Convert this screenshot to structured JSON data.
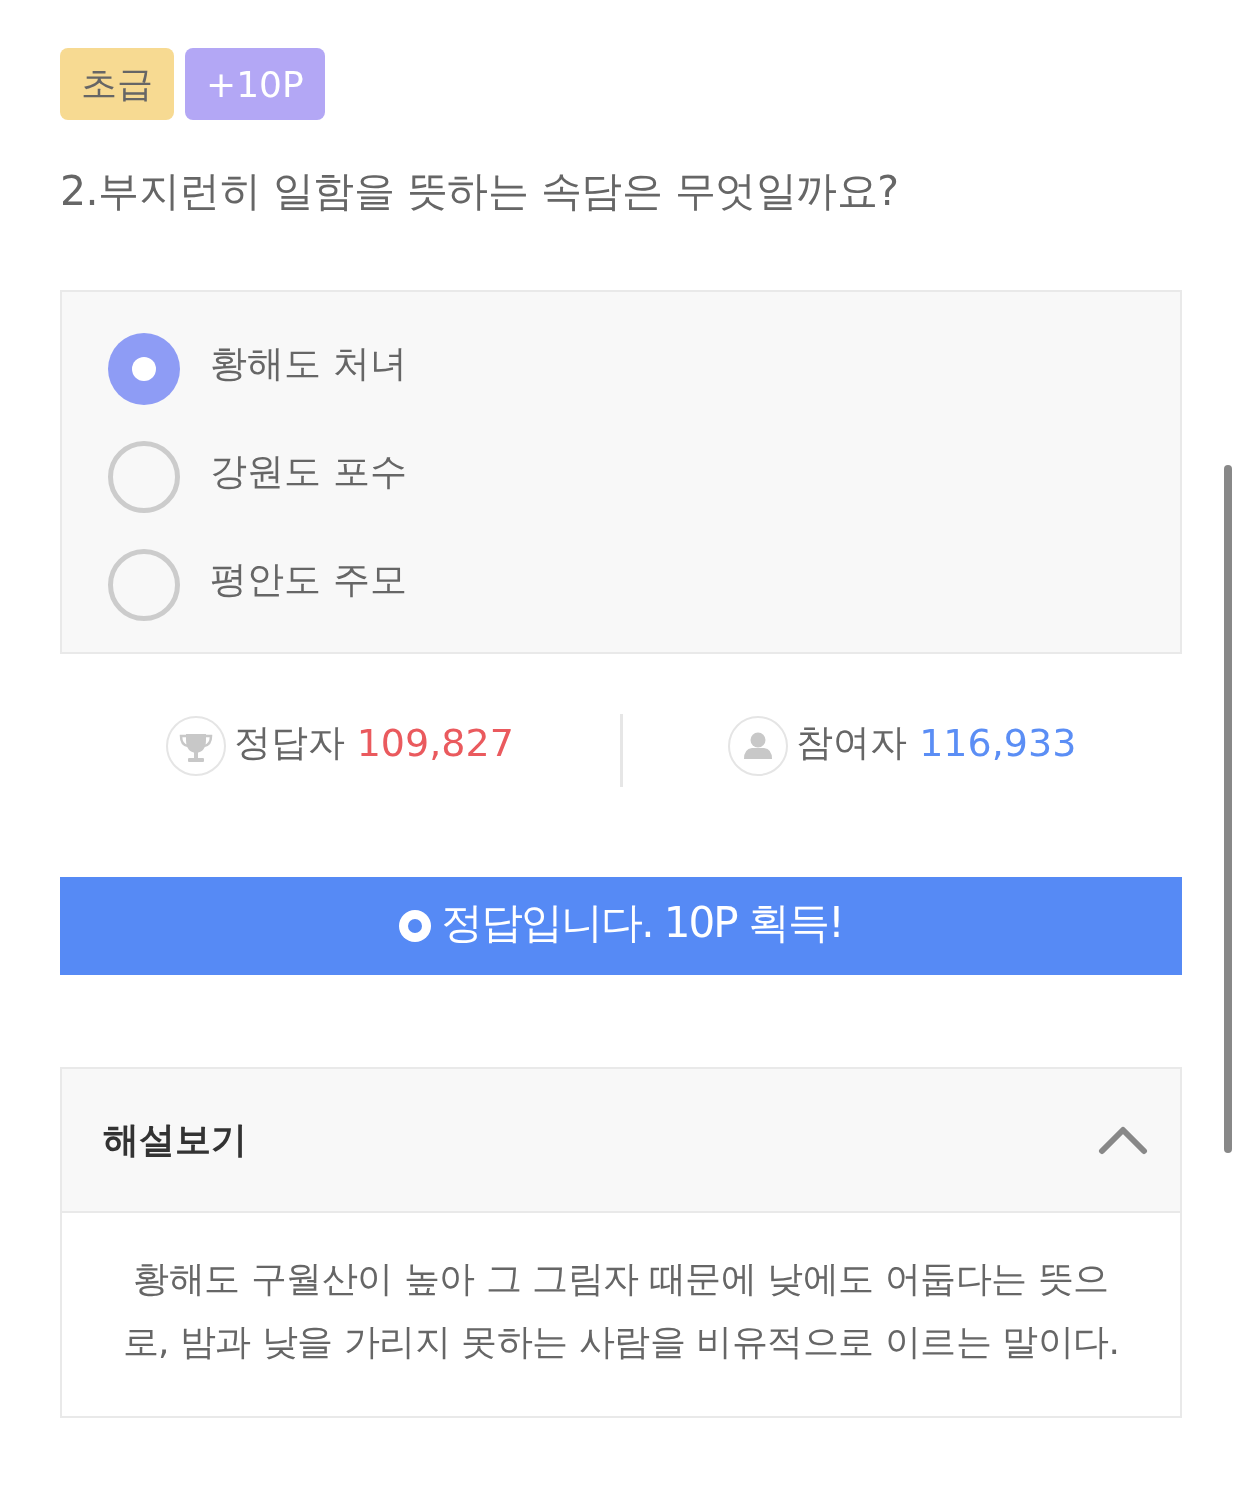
{
  "badges": [
    {
      "kind": "level",
      "label": "초급"
    },
    {
      "kind": "points",
      "label": "+10P"
    }
  ],
  "question": "2.부지런히 일함을 뜻하는 속담은 무엇일까요?",
  "options": [
    {
      "label": "황해도 처녀",
      "selected": true
    },
    {
      "label": "강원도 포수",
      "selected": false
    },
    {
      "label": "평안도 주모",
      "selected": false
    }
  ],
  "stats": [
    {
      "kind": "correct",
      "label": "정답자",
      "value": "109,827"
    },
    {
      "kind": "participants",
      "label": "참여자",
      "value": "116,933"
    }
  ],
  "result": {
    "text": "정답입니다. 10P 획득!"
  },
  "explanation": {
    "title": "해설보기",
    "expanded": true,
    "text": "황해도 구월산이 높아 그 그림자 때문에 낮에도 어둡다는 뜻으로, 밤과 낮을 가리지 못하는 사람을 비유적으로 이르는 말이다."
  }
}
